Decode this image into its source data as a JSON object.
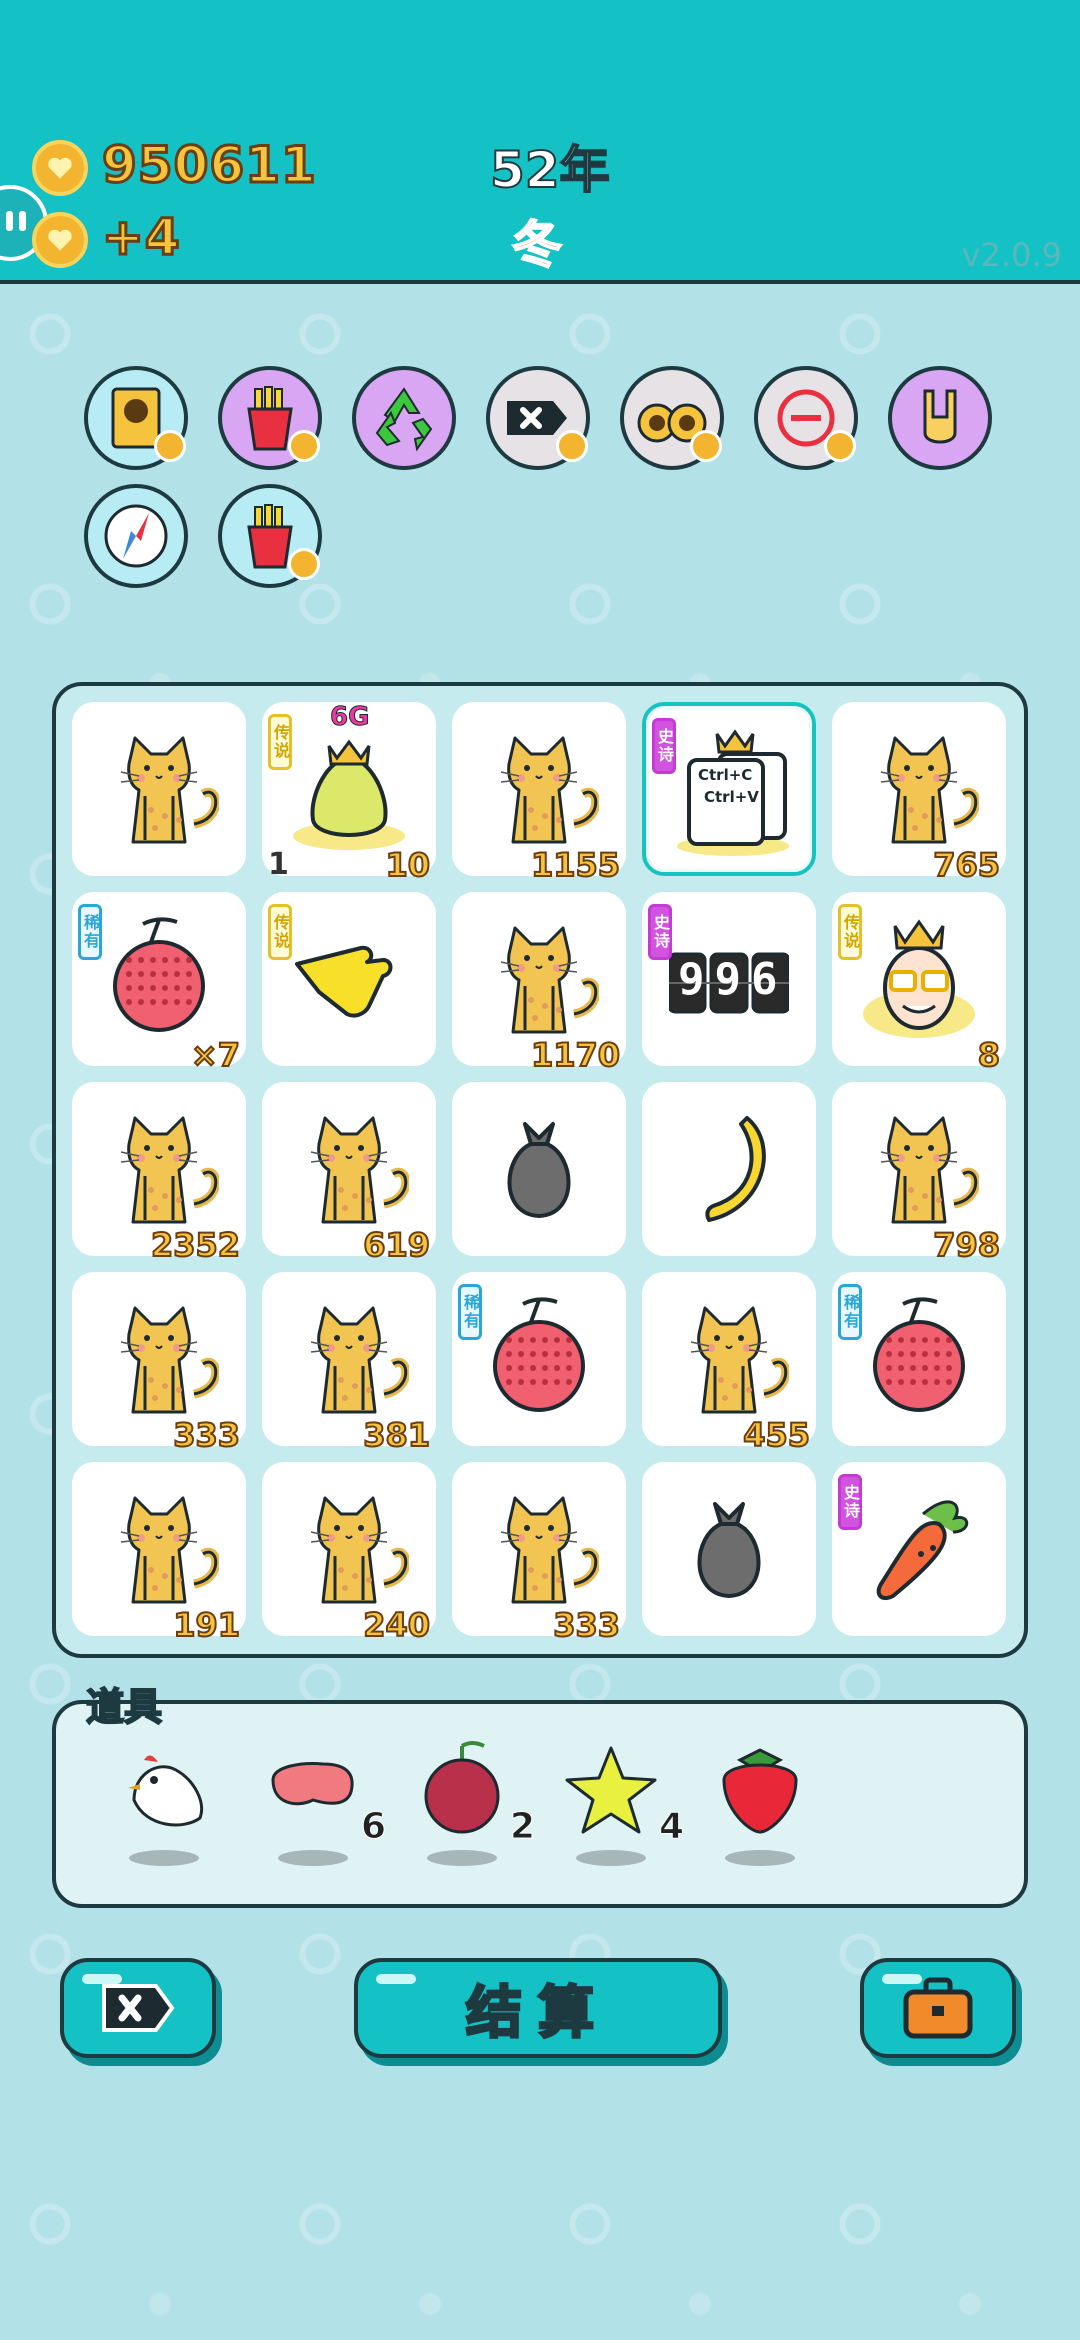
{
  "header": {
    "coins": "950611",
    "income": "+4",
    "year": "52年",
    "season": "冬",
    "version": "v2.0.9"
  },
  "skills": [
    {
      "name": "cat-portrait-icon",
      "bg": "#b8ecf5",
      "badge": true
    },
    {
      "name": "fries-icon",
      "bg": "#d9a6f3",
      "badge": true
    },
    {
      "name": "recycle-icon",
      "bg": "#d9a6f3",
      "badge": false
    },
    {
      "name": "delete-tag-icon",
      "bg": "#e6e2e6",
      "badge": true
    },
    {
      "name": "twin-cats-icon",
      "bg": "#e6e2e6",
      "badge": true
    },
    {
      "name": "minus-circle-icon",
      "bg": "#e6e2e6",
      "badge": true
    },
    {
      "name": "rock-hand-icon",
      "bg": "#d9a6f3",
      "badge": false
    },
    {
      "name": "compass-icon",
      "bg": "#b8ecf5",
      "badge": false
    },
    {
      "name": "fries-icon",
      "bg": "#b8ecf5",
      "badge": true
    }
  ],
  "grid": [
    [
      {
        "item": "cat",
        "value": ""
      },
      {
        "item": "pear-6g",
        "tag": "传说",
        "tag_type": "legend",
        "left_value": "1",
        "value": "10",
        "label": "6G"
      },
      {
        "item": "cat",
        "value": "1155"
      },
      {
        "item": "ctrl-cv",
        "tag": "史诗",
        "tag_type": "epic",
        "value": "",
        "label": "Ctrl+C",
        "label2": "Ctrl+V",
        "highlight": true
      },
      {
        "item": "cat",
        "value": "765"
      }
    ],
    [
      {
        "item": "lychee",
        "tag": "稀有",
        "tag_type": "rare",
        "value": "×7"
      },
      {
        "item": "pointing-hand",
        "tag": "传说",
        "tag_type": "legend",
        "value": ""
      },
      {
        "item": "cat",
        "value": "1170"
      },
      {
        "item": "counter-996",
        "tag": "史诗",
        "tag_type": "epic",
        "value": "",
        "label": "996"
      },
      {
        "item": "king-face",
        "tag": "传说",
        "tag_type": "legend",
        "value": "8"
      }
    ],
    [
      {
        "item": "cat",
        "value": "2352"
      },
      {
        "item": "cat",
        "value": "619"
      },
      {
        "item": "garbage-bag",
        "value": ""
      },
      {
        "item": "banana",
        "value": ""
      },
      {
        "item": "cat",
        "value": "798"
      }
    ],
    [
      {
        "item": "cat",
        "value": "333"
      },
      {
        "item": "cat",
        "value": "381"
      },
      {
        "item": "lychee",
        "tag": "稀有",
        "tag_type": "rare",
        "value": ""
      },
      {
        "item": "cat",
        "value": "455"
      },
      {
        "item": "lychee",
        "tag": "稀有",
        "tag_type": "rare",
        "value": ""
      }
    ],
    [
      {
        "item": "cat",
        "value": "191"
      },
      {
        "item": "cat",
        "value": "240"
      },
      {
        "item": "cat",
        "value": "333"
      },
      {
        "item": "garbage-bag",
        "value": ""
      },
      {
        "item": "carrot",
        "tag": "史诗",
        "tag_type": "epic",
        "value": ""
      }
    ]
  ],
  "props": {
    "title": "道具",
    "items": [
      {
        "item": "white-bird",
        "count": ""
      },
      {
        "item": "liver",
        "count": "6"
      },
      {
        "item": "bayberry",
        "count": "2"
      },
      {
        "item": "star",
        "count": "4"
      },
      {
        "item": "strawberry",
        "count": ""
      }
    ]
  },
  "buttons": {
    "settle": "结算"
  },
  "colors": {
    "topbar": "#14c1c4",
    "background": "#b3e1e8",
    "gold": "#f6c33d",
    "outline": "#1d3a40"
  }
}
